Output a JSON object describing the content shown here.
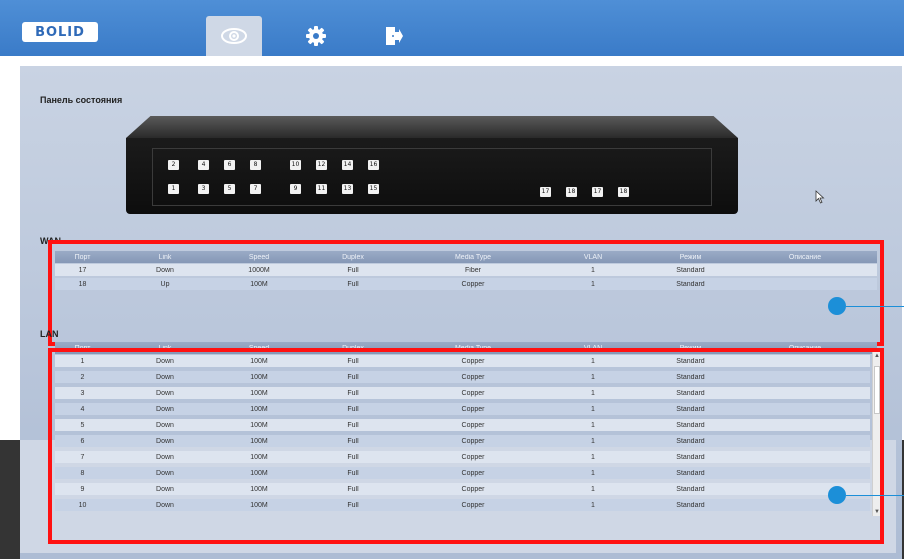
{
  "header": {
    "logo_text": "BOLID",
    "nav": [
      {
        "name": "eye-icon",
        "active": true
      },
      {
        "name": "gear-icon",
        "active": false
      },
      {
        "name": "exit-icon",
        "active": false
      }
    ]
  },
  "status_panel": {
    "title": "Панель состояния",
    "ports_top": [
      "2",
      "4",
      "6",
      "8",
      "10",
      "12",
      "14",
      "16"
    ],
    "ports_bottom": [
      "1",
      "3",
      "5",
      "7",
      "9",
      "11",
      "13",
      "15"
    ],
    "ports_sfp": [
      "17",
      "18",
      "17",
      "18"
    ]
  },
  "wan": {
    "label": "WAN",
    "columns": [
      "Порт",
      "Link",
      "Speed",
      "Duplex",
      "Media Type",
      "VLAN",
      "Режим",
      "Описание"
    ],
    "rows": [
      [
        "17",
        "Down",
        "1000M",
        "Full",
        "Fiber",
        "1",
        "Standard",
        ""
      ],
      [
        "18",
        "Up",
        "100M",
        "Full",
        "Copper",
        "1",
        "Standard",
        ""
      ]
    ]
  },
  "lan": {
    "label": "LAN",
    "columns": [
      "Порт",
      "Link",
      "Speed",
      "Duplex",
      "Media Type",
      "VLAN",
      "Режим",
      "Описание"
    ],
    "rows": [
      [
        "1",
        "Down",
        "100M",
        "Full",
        "Copper",
        "1",
        "Standard",
        ""
      ],
      [
        "2",
        "Down",
        "100M",
        "Full",
        "Copper",
        "1",
        "Standard",
        ""
      ],
      [
        "3",
        "Down",
        "100M",
        "Full",
        "Copper",
        "1",
        "Standard",
        ""
      ],
      [
        "4",
        "Down",
        "100M",
        "Full",
        "Copper",
        "1",
        "Standard",
        ""
      ],
      [
        "5",
        "Down",
        "100M",
        "Full",
        "Copper",
        "1",
        "Standard",
        ""
      ],
      [
        "6",
        "Down",
        "100M",
        "Full",
        "Copper",
        "1",
        "Standard",
        ""
      ],
      [
        "7",
        "Down",
        "100M",
        "Full",
        "Copper",
        "1",
        "Standard",
        ""
      ],
      [
        "8",
        "Down",
        "100M",
        "Full",
        "Copper",
        "1",
        "Standard",
        ""
      ],
      [
        "9",
        "Down",
        "100M",
        "Full",
        "Copper",
        "1",
        "Standard",
        ""
      ],
      [
        "10",
        "Down",
        "100M",
        "Full",
        "Copper",
        "1",
        "Standard",
        ""
      ]
    ]
  },
  "colors": {
    "header_blue": "#3a7bc8",
    "highlight_red": "#ff1111",
    "marker_blue": "#1c8fd8"
  }
}
